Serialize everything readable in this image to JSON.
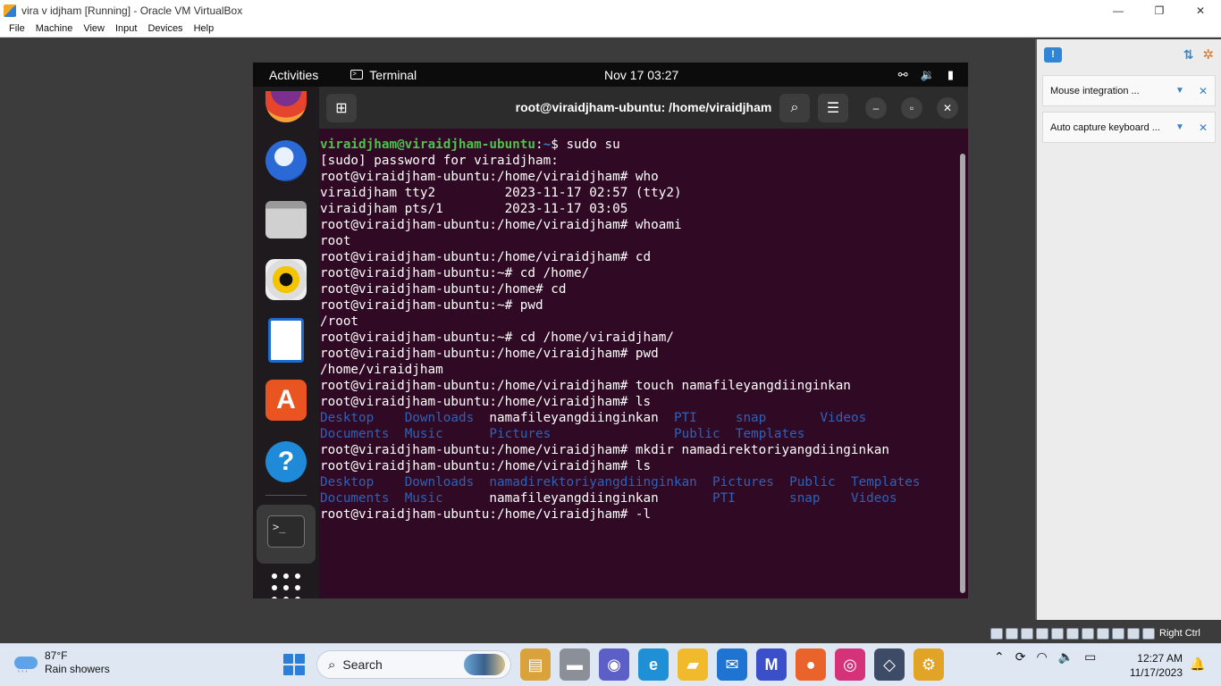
{
  "host_window": {
    "title": "vira v idjham  [Running] - Oracle VM VirtualBox",
    "controls": [
      "—",
      "❐",
      "✕"
    ],
    "menu": [
      "File",
      "Machine",
      "View",
      "Input",
      "Devices",
      "Help"
    ]
  },
  "notifications": {
    "items": [
      {
        "text": "Mouse integration ..."
      },
      {
        "text": "Auto capture keyboard ..."
      }
    ]
  },
  "statusbar": {
    "host_key_label": "Right Ctrl"
  },
  "guest": {
    "topbar": {
      "activities": "Activities",
      "app_name": "Terminal",
      "clock": "Nov 17  03:27"
    },
    "terminal": {
      "title": "root@viraidjham-ubuntu: /home/viraidjham",
      "lines": [
        {
          "segs": [
            {
              "t": "viraidjham@viraidjham-ubuntu",
              "c": "ps-user"
            },
            {
              "t": ":",
              "c": ""
            },
            {
              "t": "~",
              "c": "ps-path"
            },
            {
              "t": "$ sudo su",
              "c": ""
            }
          ]
        },
        {
          "segs": [
            {
              "t": "[sudo] password for viraidjham:",
              "c": ""
            }
          ]
        },
        {
          "segs": [
            {
              "t": "root@viraidjham-ubuntu:/home/viraidjham# who",
              "c": ""
            }
          ]
        },
        {
          "segs": [
            {
              "t": "viraidjham tty2         2023-11-17 02:57 (tty2)",
              "c": ""
            }
          ]
        },
        {
          "segs": [
            {
              "t": "viraidjham pts/1        2023-11-17 03:05",
              "c": ""
            }
          ]
        },
        {
          "segs": [
            {
              "t": "root@viraidjham-ubuntu:/home/viraidjham# whoami",
              "c": ""
            }
          ]
        },
        {
          "segs": [
            {
              "t": "root",
              "c": ""
            }
          ]
        },
        {
          "segs": [
            {
              "t": "root@viraidjham-ubuntu:/home/viraidjham# cd",
              "c": ""
            }
          ]
        },
        {
          "segs": [
            {
              "t": "root@viraidjham-ubuntu:~# cd /home/",
              "c": ""
            }
          ]
        },
        {
          "segs": [
            {
              "t": "root@viraidjham-ubuntu:/home# cd",
              "c": ""
            }
          ]
        },
        {
          "segs": [
            {
              "t": "root@viraidjham-ubuntu:~# pwd",
              "c": ""
            }
          ]
        },
        {
          "segs": [
            {
              "t": "/root",
              "c": ""
            }
          ]
        },
        {
          "segs": [
            {
              "t": "root@viraidjham-ubuntu:~# cd /home/viraidjham/",
              "c": ""
            }
          ]
        },
        {
          "segs": [
            {
              "t": "root@viraidjham-ubuntu:/home/viraidjham# pwd",
              "c": ""
            }
          ]
        },
        {
          "segs": [
            {
              "t": "/home/viraidjham",
              "c": ""
            }
          ]
        },
        {
          "segs": [
            {
              "t": "root@viraidjham-ubuntu:/home/viraidjham# touch namafileyangdiinginkan",
              "c": ""
            }
          ]
        },
        {
          "segs": [
            {
              "t": "root@viraidjham-ubuntu:/home/viraidjham# ls",
              "c": ""
            }
          ]
        },
        {
          "segs": [
            {
              "t": "Desktop",
              "c": "dir"
            },
            {
              "t": "    ",
              "c": ""
            },
            {
              "t": "Downloads",
              "c": "dir"
            },
            {
              "t": "  namafileyangdiinginkan  ",
              "c": ""
            },
            {
              "t": "PTI",
              "c": "dir"
            },
            {
              "t": "     ",
              "c": ""
            },
            {
              "t": "snap",
              "c": "dir"
            },
            {
              "t": "       ",
              "c": ""
            },
            {
              "t": "Videos",
              "c": "dir"
            }
          ]
        },
        {
          "segs": [
            {
              "t": "Documents",
              "c": "dir"
            },
            {
              "t": "  ",
              "c": ""
            },
            {
              "t": "Music",
              "c": "dir"
            },
            {
              "t": "      ",
              "c": ""
            },
            {
              "t": "Pictures",
              "c": "dir"
            },
            {
              "t": "                ",
              "c": ""
            },
            {
              "t": "Public",
              "c": "dir"
            },
            {
              "t": "  ",
              "c": ""
            },
            {
              "t": "Templates",
              "c": "dir"
            }
          ]
        },
        {
          "segs": [
            {
              "t": "root@viraidjham-ubuntu:/home/viraidjham# mkdir namadirektoriyangdiinginkan",
              "c": ""
            }
          ]
        },
        {
          "segs": [
            {
              "t": "root@viraidjham-ubuntu:/home/viraidjham# ls",
              "c": ""
            }
          ]
        },
        {
          "segs": [
            {
              "t": "Desktop",
              "c": "dir"
            },
            {
              "t": "    ",
              "c": ""
            },
            {
              "t": "Downloads",
              "c": "dir"
            },
            {
              "t": "  ",
              "c": ""
            },
            {
              "t": "namadirektoriyangdiinginkan",
              "c": "dir"
            },
            {
              "t": "  ",
              "c": ""
            },
            {
              "t": "Pictures",
              "c": "dir"
            },
            {
              "t": "  ",
              "c": ""
            },
            {
              "t": "Public",
              "c": "dir"
            },
            {
              "t": "  ",
              "c": ""
            },
            {
              "t": "Templates",
              "c": "dir"
            }
          ]
        },
        {
          "segs": [
            {
              "t": "Documents",
              "c": "dir"
            },
            {
              "t": "  ",
              "c": ""
            },
            {
              "t": "Music",
              "c": "dir"
            },
            {
              "t": "      namafileyangdiinginkan       ",
              "c": ""
            },
            {
              "t": "PTI",
              "c": "dir"
            },
            {
              "t": "       ",
              "c": ""
            },
            {
              "t": "snap",
              "c": "dir"
            },
            {
              "t": "    ",
              "c": ""
            },
            {
              "t": "Videos",
              "c": "dir"
            }
          ]
        },
        {
          "segs": [
            {
              "t": "root@viraidjham-ubuntu:/home/viraidjham# -l",
              "c": ""
            }
          ]
        }
      ]
    }
  },
  "taskbar": {
    "weather": {
      "temp": "87°F",
      "desc": "Rain showers"
    },
    "search_label": "Search",
    "apps": [
      {
        "name": "photos-app",
        "label": "▤",
        "bg": "#d9a23a"
      },
      {
        "name": "file-explorer-app",
        "label": "▬",
        "bg": "#8a8f98"
      },
      {
        "name": "teams-app",
        "label": "◉",
        "bg": "#5b5fc7"
      },
      {
        "name": "edge-app",
        "label": "e",
        "bg": "#1f8fd6"
      },
      {
        "name": "folder-app",
        "label": "▰",
        "bg": "#f1b92c"
      },
      {
        "name": "mail-app",
        "label": "✉",
        "bg": "#1f73d1"
      },
      {
        "name": "app-tile",
        "label": "M",
        "bg": "#3a4fc9"
      },
      {
        "name": "firefox-app",
        "label": "●",
        "bg": "#e9632a"
      },
      {
        "name": "instagram-app",
        "label": "◎",
        "bg": "#d6327a"
      },
      {
        "name": "virtualbox-app",
        "label": "◇",
        "bg": "#3e4b66"
      },
      {
        "name": "app-tile-2",
        "label": "⚙",
        "bg": "#e2a427"
      }
    ],
    "time": "12:27 AM",
    "date": "11/17/2023"
  },
  "colors": {
    "terminal_bg": "#300a24",
    "prompt_user": "#4ec14f",
    "directory": "#2d62b8",
    "ubuntu_orange": "#e95420"
  }
}
